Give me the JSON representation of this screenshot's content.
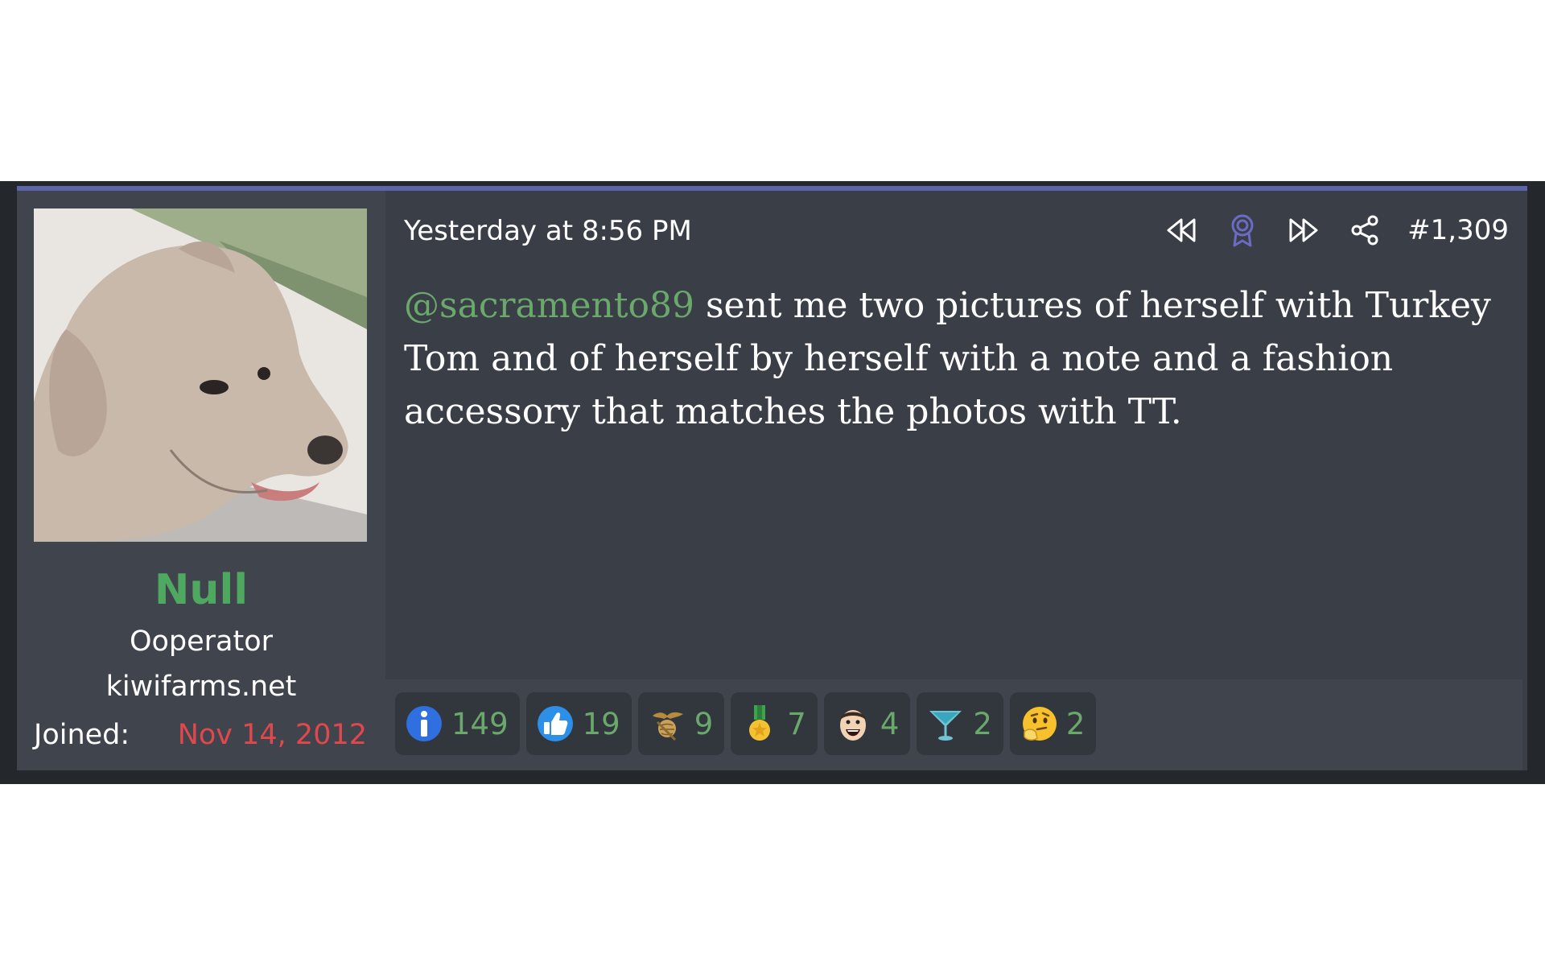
{
  "post": {
    "timestamp": "Yesterday at 8:56 PM",
    "post_number": "#1,309",
    "mention": "@sacramento89",
    "body": " sent me two pictures of herself with Turkey Tom and of herself by herself with a note and a fashion accessory that matches the photos with TT.",
    "actions": [
      {
        "icon": "rewind-icon"
      },
      {
        "icon": "award-icon"
      },
      {
        "icon": "fast-forward-icon"
      },
      {
        "icon": "share-icon"
      }
    ]
  },
  "user": {
    "name": "Null",
    "title": "Ooperator",
    "site": "kiwifarms.net",
    "joined_label": "Joined:",
    "joined_date": "Nov 14, 2012",
    "avatar": "dog-avatar-icon"
  },
  "reactions": [
    {
      "icon": "informative-icon",
      "count": "149"
    },
    {
      "icon": "thumbs-up-icon",
      "count": "19"
    },
    {
      "icon": "eagle-globe-anchor-icon",
      "count": "9"
    },
    {
      "icon": "medal-icon",
      "count": "7"
    },
    {
      "icon": "laughing-face-icon",
      "count": "4"
    },
    {
      "icon": "cocktail-glass-icon",
      "count": "2"
    },
    {
      "icon": "thinking-face-icon",
      "count": "2"
    }
  ],
  "colors": {
    "username": "#4fa860",
    "mention": "#6aa86b",
    "joined_date": "#e0484d",
    "post_bg": "#3a3e46",
    "accent_border": "#5e64a8"
  }
}
